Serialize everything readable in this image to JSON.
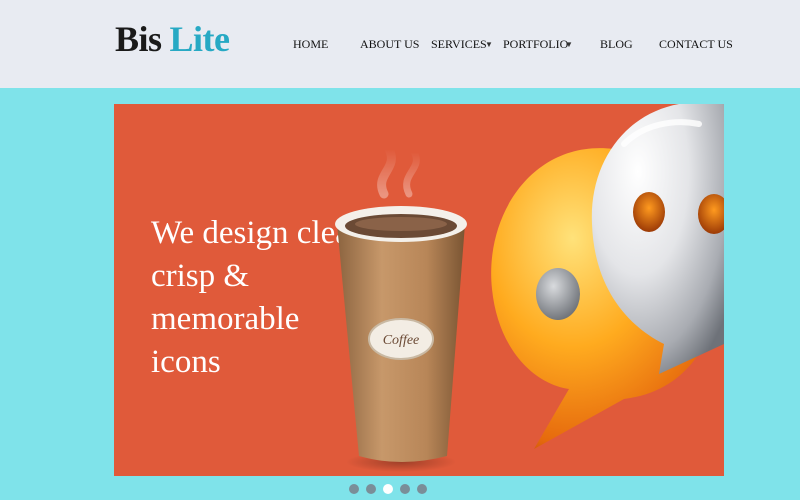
{
  "header": {
    "logo_part1": "Bis",
    "logo_part2": "Lite"
  },
  "nav": {
    "items": [
      {
        "label": "HOME"
      },
      {
        "label": "ABOUT US"
      },
      {
        "label": "SERVICES"
      },
      {
        "label": "PORTFOLIO"
      },
      {
        "label": "BLOG"
      },
      {
        "label": "CONTACT US"
      }
    ],
    "caret_icon": "chevron-down-icon"
  },
  "hero": {
    "headline_lines": [
      "We design clean,",
      "crisp &",
      "memorable",
      "icons"
    ],
    "cup_label": "Coffee",
    "background_color": "#e05a3a"
  },
  "slider": {
    "slide_count": 5,
    "active_index": 3
  },
  "colors": {
    "page_bg": "#7fe3ea",
    "header_bg": "#e8ebf2",
    "brand_accent": "#27a9c4"
  }
}
